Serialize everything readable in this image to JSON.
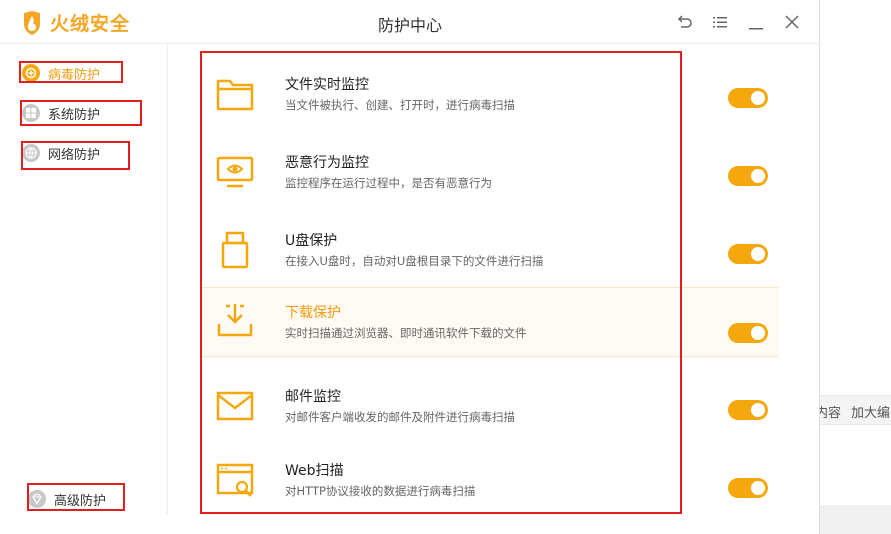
{
  "app": {
    "brand": "火绒安全",
    "window_title": "防护中心"
  },
  "controls": {
    "back": "back-icon",
    "menu": "menu-icon",
    "minimize": "minimize-icon",
    "close": "close-icon"
  },
  "sidebar": {
    "items": [
      {
        "label": "病毒防护",
        "icon": "virus-shield-icon",
        "active": true
      },
      {
        "label": "系统防护",
        "icon": "windows-icon",
        "active": false
      },
      {
        "label": "网络防护",
        "icon": "globe-icon",
        "active": false
      }
    ],
    "bottom_item": {
      "label": "高级防护",
      "icon": "diamond-icon"
    }
  },
  "features": [
    {
      "title": "文件实时监控",
      "desc": "当文件被执行、创建、打开时，进行病毒扫描",
      "icon": "folder-icon",
      "enabled": true
    },
    {
      "title": "恶意行为监控",
      "desc": "监控程序在运行过程中，是否有恶意行为",
      "icon": "monitor-eye-icon",
      "enabled": true
    },
    {
      "title": "U盘保护",
      "desc": "在接入U盘时，自动对U盘根目录下的文件进行扫描",
      "icon": "usb-drive-icon",
      "enabled": true
    },
    {
      "title": "下载保护",
      "desc": "实时扫描通过浏览器、即时通讯软件下载的文件",
      "icon": "download-tray-icon",
      "enabled": true
    },
    {
      "title": "邮件监控",
      "desc": "对邮件客户端收发的邮件及附件进行病毒扫描",
      "icon": "mail-icon",
      "enabled": true
    },
    {
      "title": "Web扫描",
      "desc": "对HTTP协议接收的数据进行病毒扫描",
      "icon": "web-scan-icon",
      "enabled": true
    }
  ],
  "background": {
    "text_1": "内容",
    "text_2": "加大编"
  },
  "colors": {
    "accent": "#f5a80e",
    "highlight_bg": "#fffaf3",
    "annotation_red": "#e02020"
  }
}
